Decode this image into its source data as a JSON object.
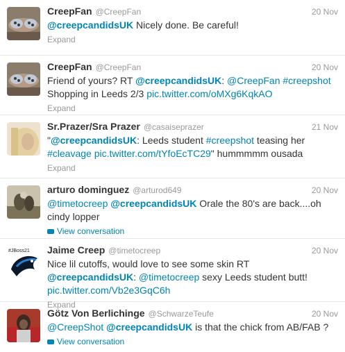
{
  "tweets": [
    {
      "name": "CreepFan",
      "handle": "@CreepFan",
      "time": "20 Nov",
      "body": [
        {
          "t": "@creepcandidsUK",
          "c": "u"
        },
        {
          "t": " Nicely done.  Be careful!",
          "c": ""
        }
      ],
      "footer": "Expand",
      "footer_type": "expand"
    },
    {
      "name": "CreepFan",
      "handle": "@CreepFan",
      "time": "20 Nov",
      "body": [
        {
          "t": "Friend of yours? RT ",
          "c": ""
        },
        {
          "t": "@creepcandidsUK",
          "c": "u"
        },
        {
          "t": ": ",
          "c": ""
        },
        {
          "t": "@CreepFan",
          "c": "l"
        },
        {
          "t": " ",
          "c": ""
        },
        {
          "t": "#creepshot",
          "c": "l"
        },
        {
          "t": " Shopping in Leeds 2/3 ",
          "c": ""
        },
        {
          "t": "pic.twitter.com/oMXg6KqkAO",
          "c": "l"
        }
      ],
      "footer": "Expand",
      "footer_type": "expand"
    },
    {
      "name": "Sr.Prazer/Sra Prazer",
      "handle": "@casaiseprazer",
      "time": "21 Nov",
      "body": [
        {
          "t": "\"",
          "c": ""
        },
        {
          "t": "@creepcandidsUK",
          "c": "u"
        },
        {
          "t": ": Leeds student ",
          "c": ""
        },
        {
          "t": "#creepshot",
          "c": "l"
        },
        {
          "t": " teasing her ",
          "c": ""
        },
        {
          "t": "#cleavage",
          "c": "l"
        },
        {
          "t": " ",
          "c": ""
        },
        {
          "t": "pic.twitter.com/tYfoEcTC29",
          "c": "l"
        },
        {
          "t": "\" hummmmm ousada",
          "c": ""
        }
      ],
      "footer": "Expand",
      "footer_type": "expand"
    },
    {
      "name": "arturo dominguez",
      "handle": "@arturod649",
      "time": "20 Nov",
      "body": [
        {
          "t": "@timetocreep",
          "c": "l"
        },
        {
          "t": " ",
          "c": ""
        },
        {
          "t": "@creepcandidsUK",
          "c": "u"
        },
        {
          "t": " Orale the 80's are back....oh cindy lopper",
          "c": ""
        }
      ],
      "footer": "View conversation",
      "footer_type": "conversation"
    },
    {
      "name": "Jaime Creep",
      "handle": "@timetocreep",
      "time": "20 Nov",
      "avatar_text": "#JBoss21",
      "body": [
        {
          "t": "Nice lil cutoffs, would love to see some skin RT ",
          "c": ""
        },
        {
          "t": "@creepcandidsUK",
          "c": "u"
        },
        {
          "t": ": ",
          "c": ""
        },
        {
          "t": "@timetocreep",
          "c": "l"
        },
        {
          "t": " sexy Leeds student butt! ",
          "c": ""
        },
        {
          "t": "pic.twitter.com/Vb2e3GqC6h",
          "c": "l"
        }
      ],
      "footer": "Expand",
      "footer_type": "expand"
    },
    {
      "name": "Götz Von Berlichinge",
      "handle": "@SchwarzeTeufe",
      "time": "20 Nov",
      "body": [
        {
          "t": "@CreepShot",
          "c": "l"
        },
        {
          "t": " ",
          "c": ""
        },
        {
          "t": "@creepcandidsUK",
          "c": "u"
        },
        {
          "t": " is that the chick from AB/FAB ?",
          "c": ""
        }
      ],
      "footer": "View conversation",
      "footer_type": "conversation"
    }
  ],
  "colors": {
    "link": "#0084b4",
    "meta": "#999999",
    "text": "#333333",
    "divider": "#e8e8e8"
  }
}
